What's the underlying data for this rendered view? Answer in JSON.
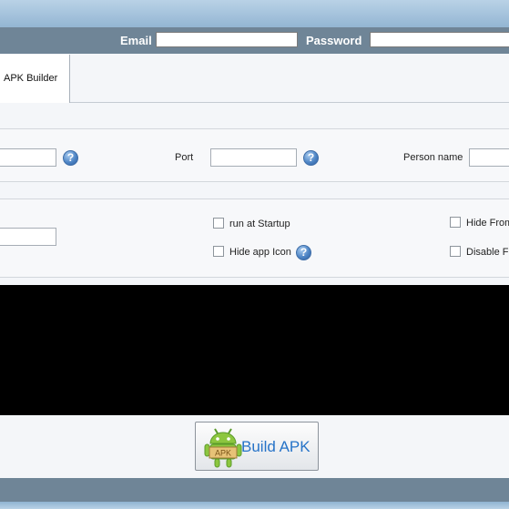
{
  "login": {
    "email_label": "Email",
    "email_value": "",
    "password_label": "Password",
    "password_value": ""
  },
  "tabs": [
    {
      "label": "APK Builder",
      "active": true
    }
  ],
  "connection": {
    "host_value": "",
    "port_label": "Port",
    "port_value": "",
    "person_label": "Person name",
    "person_value": ""
  },
  "options": {
    "field_value": "",
    "run_startup_label": "run at Startup",
    "hide_icon_label": "Hide app Icon",
    "hide_from_label": "Hide From",
    "disable_label": "Disable Fo"
  },
  "help_glyph": "?",
  "build": {
    "label": "Build APK",
    "icon": "android-apk-icon",
    "badge": "APK"
  },
  "colors": {
    "title_bar": "#a4c2dc",
    "login_bar": "#6f8597",
    "console": "#000000",
    "build_text": "#2673c8"
  }
}
